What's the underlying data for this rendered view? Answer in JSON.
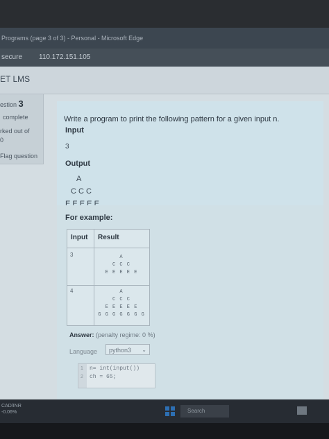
{
  "window": {
    "title": "Programs (page 3 of 3) - Personal - Microsoft Edge"
  },
  "address": {
    "security": "secure",
    "url": "110.172.151.105"
  },
  "header": {
    "brand": "ET LMS"
  },
  "question_info": {
    "prefix": "estion",
    "number": "3",
    "state": "complete",
    "marked": "rked out of",
    "marked_value": "0",
    "flag": "Flag question"
  },
  "question": {
    "text": "Write a program to print the following pattern for a given input n.",
    "input_label": "Input",
    "input_value": "3",
    "output_label": "Output",
    "pattern": [
      "A",
      "C C C",
      "E E E E E"
    ]
  },
  "example": {
    "label": "For example:",
    "headers": [
      "Input",
      "Result"
    ],
    "rows": [
      {
        "input": "3",
        "result": [
          "A",
          "C C C",
          "E E E E E"
        ]
      },
      {
        "input": "4",
        "result": [
          "A",
          "C C C",
          "E E E E E",
          "G G G G G G G"
        ]
      }
    ]
  },
  "answer": {
    "label": "Answer:",
    "penalty": "(penalty regime: 0 %)",
    "language_label": "Language",
    "language_value": "python3",
    "code_lines": [
      {
        "num": "1",
        "text": "n= int(input())"
      },
      {
        "num": "2",
        "text": "ch = 65;"
      }
    ]
  },
  "taskbar": {
    "left_text_1": "CAD/INR",
    "left_text_2": "-0.06%",
    "search": "Search"
  },
  "colors": {
    "content_bg": "#d4dde2",
    "question_bg": "#cfe2ea",
    "browser_chrome": "#3c4650"
  }
}
